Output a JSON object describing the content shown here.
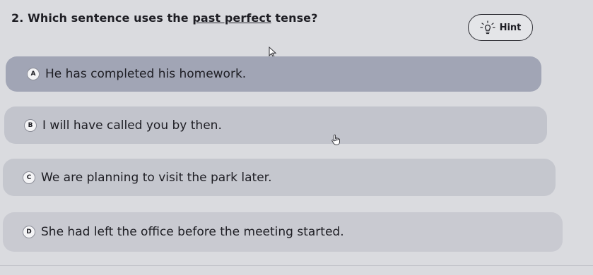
{
  "question": {
    "number": "2.",
    "before": "Which sentence uses the ",
    "underlined": "past perfect",
    "after": " tense?"
  },
  "hint": {
    "label": "Hint",
    "icon": "lightbulb-icon"
  },
  "options": [
    {
      "letter": "A",
      "text": "He has completed his homework."
    },
    {
      "letter": "B",
      "text": "I will have called you by then."
    },
    {
      "letter": "C",
      "text": "We are planning to visit the park later."
    },
    {
      "letter": "D",
      "text": "She had left the office before the meeting started."
    }
  ]
}
